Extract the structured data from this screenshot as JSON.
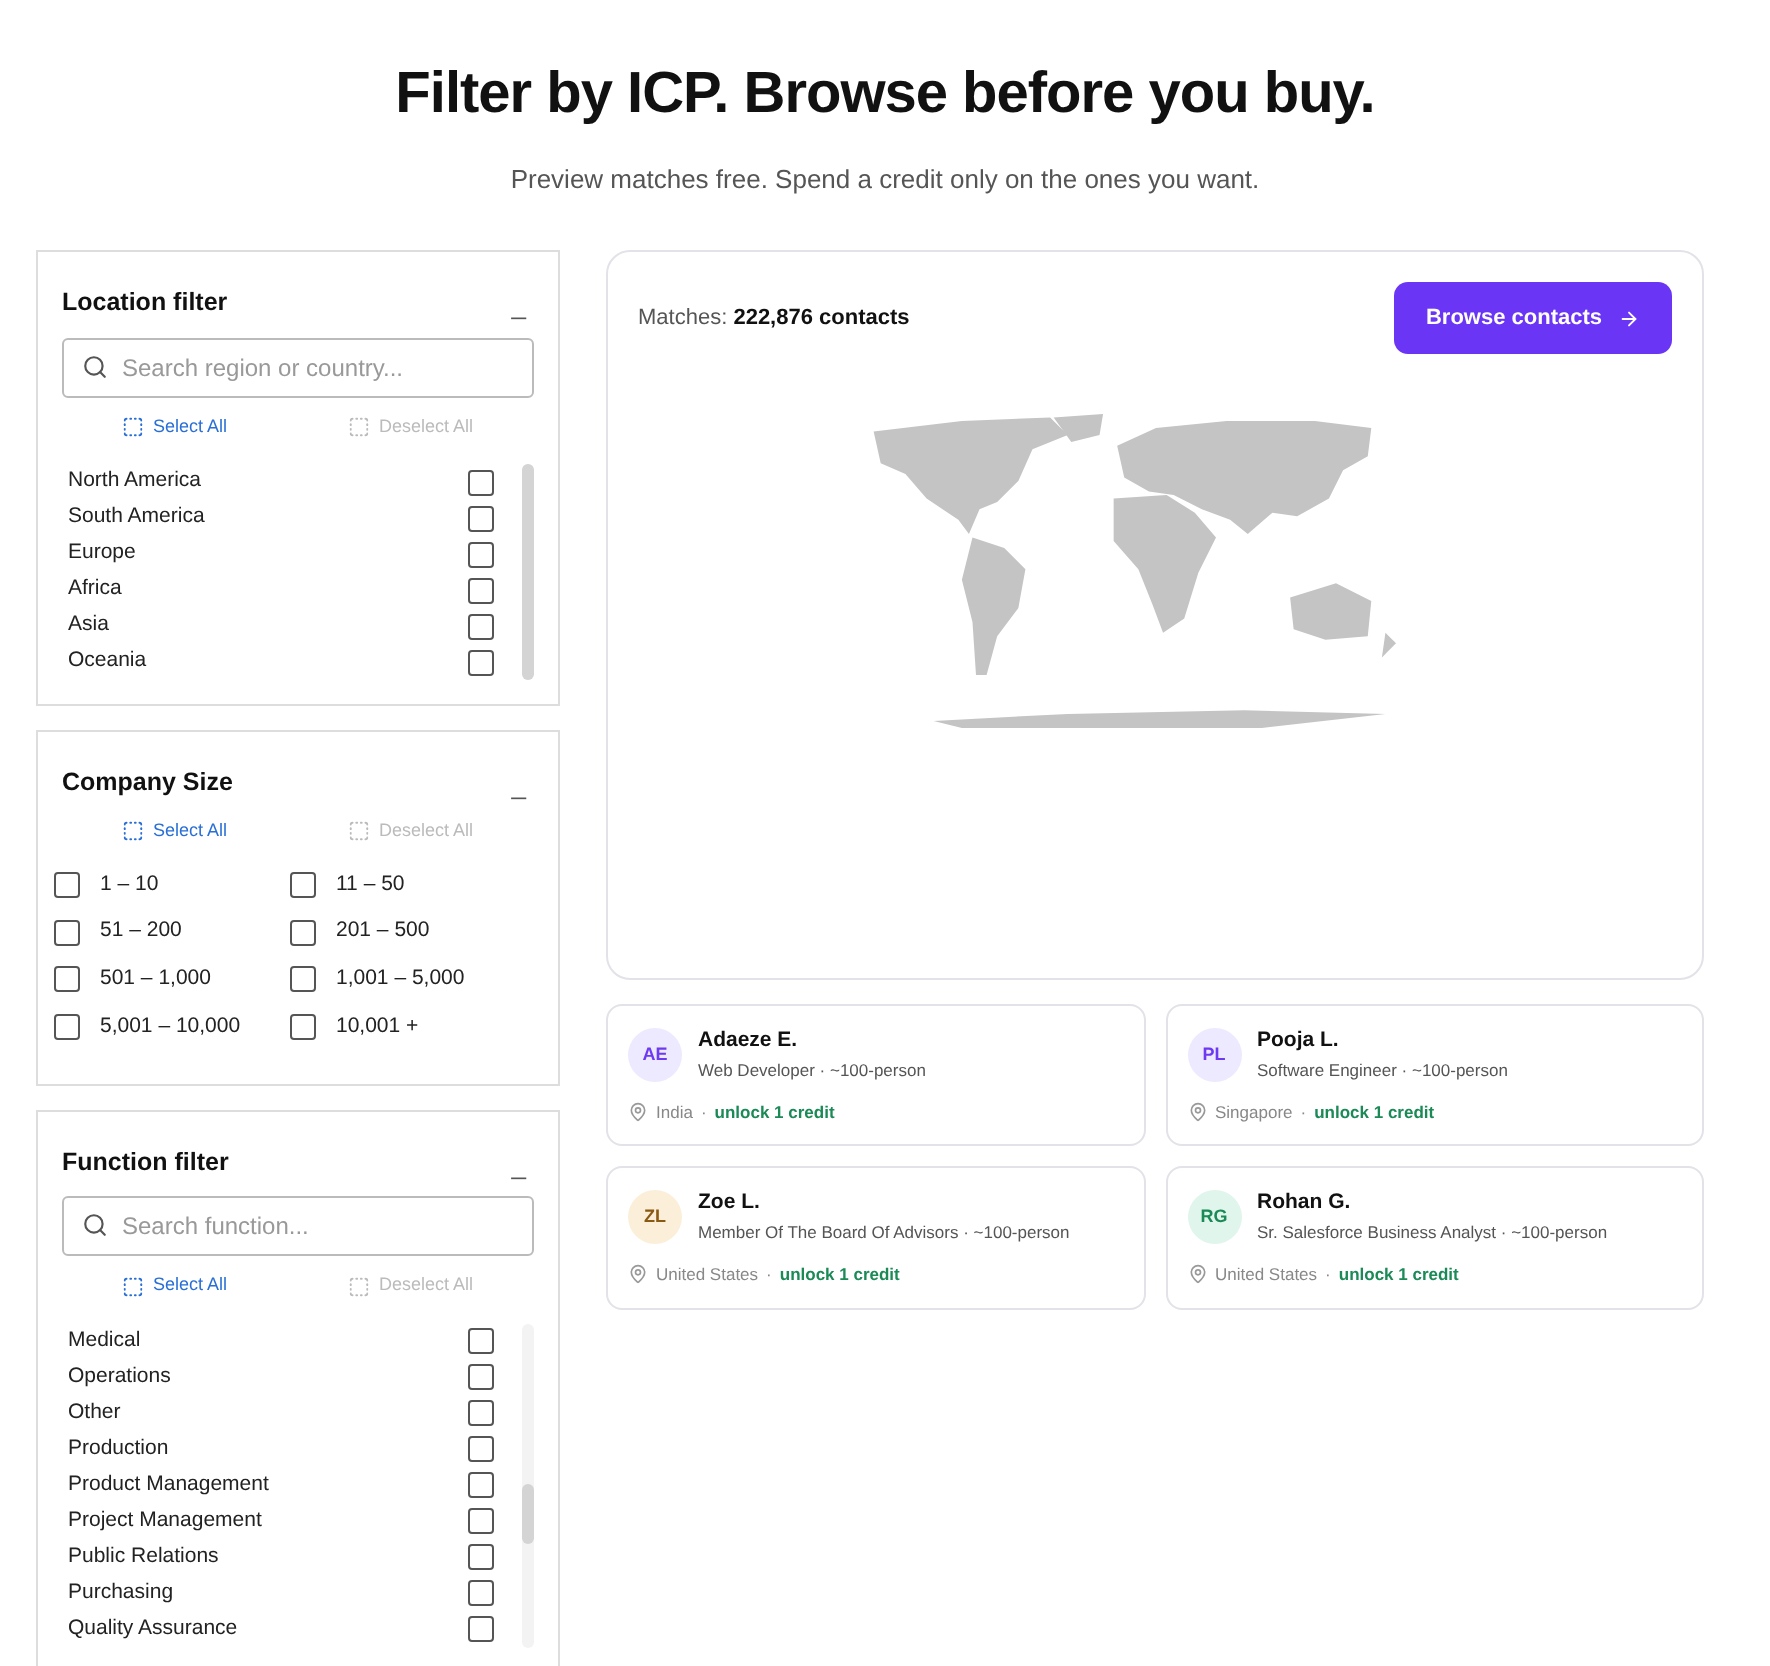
{
  "header": {
    "title": "Filter by ICP. Browse before you buy.",
    "subtitle": "Preview matches free. Spend a credit only on the ones you want."
  },
  "filters": [
    {
      "kind": "list",
      "title": "Location filter",
      "collapse": "_",
      "placeholder": "Search region or country...",
      "select_all": "Select All",
      "deselect_all": "Deselect All",
      "options": [
        {
          "label": "North America",
          "checked": false
        },
        {
          "label": "South America",
          "checked": false
        },
        {
          "label": "Europe",
          "checked": false
        },
        {
          "label": "Africa",
          "checked": false
        },
        {
          "label": "Asia",
          "checked": false
        },
        {
          "label": "Oceania",
          "checked": false
        }
      ]
    },
    {
      "kind": "grid",
      "title": "Company Size",
      "collapse": "_",
      "select_all": "Select All",
      "deselect_all": "Deselect All",
      "options": [
        {
          "label": "1 – 10",
          "checked": false
        },
        {
          "label": "11 – 50",
          "checked": false
        },
        {
          "label": "51 – 200",
          "checked": false
        },
        {
          "label": "201 – 500",
          "checked": false
        },
        {
          "label": "501 – 1,000",
          "checked": false
        },
        {
          "label": "1,001 – 5,000",
          "checked": false
        },
        {
          "label": "5,001 – 10,000",
          "checked": false
        },
        {
          "label": "10,001 +",
          "checked": false
        }
      ]
    },
    {
      "kind": "list",
      "title": "Function filter",
      "collapse": "_",
      "placeholder": "Search function...",
      "select_all": "Select All",
      "deselect_all": "Deselect All",
      "options": [
        {
          "label": "Medical",
          "checked": false
        },
        {
          "label": "Operations",
          "checked": false
        },
        {
          "label": "Other",
          "checked": false
        },
        {
          "label": "Production",
          "checked": false
        },
        {
          "label": "Product Management",
          "checked": false
        },
        {
          "label": "Project Management",
          "checked": false
        },
        {
          "label": "Public Relations",
          "checked": false
        },
        {
          "label": "Purchasing",
          "checked": false
        },
        {
          "label": "Quality Assurance",
          "checked": false
        }
      ]
    }
  ],
  "matches": {
    "label": "Matches:",
    "count": "222,876 contacts",
    "button": "Browse contacts"
  },
  "contacts": [
    {
      "initials": "AE",
      "color": "#ede9fe",
      "name": "Adaeze E.",
      "role": "Web Developer · ~100-person",
      "location": "India",
      "separator": "·",
      "unlock": "unlock 1 credit"
    },
    {
      "initials": "PL",
      "color": "#ede9fe",
      "name": "Pooja L.",
      "role": "Software Engineer · ~100-person",
      "location": "Singapore",
      "separator": "·",
      "unlock": "unlock 1 credit"
    },
    {
      "initials": "ZL",
      "color": "#fbefd9",
      "name": "Zoe L.",
      "role": "Member Of The Board Of Advisors · ~100-person",
      "location": "United States",
      "separator": "·",
      "unlock": "unlock 1 credit"
    },
    {
      "initials": "RG",
      "color": "#e0f5ec",
      "name": "Rohan G.",
      "role": "Sr. Salesforce Business Analyst · ~100-person",
      "location": "United States",
      "separator": "·",
      "unlock": "unlock 1 credit"
    }
  ]
}
